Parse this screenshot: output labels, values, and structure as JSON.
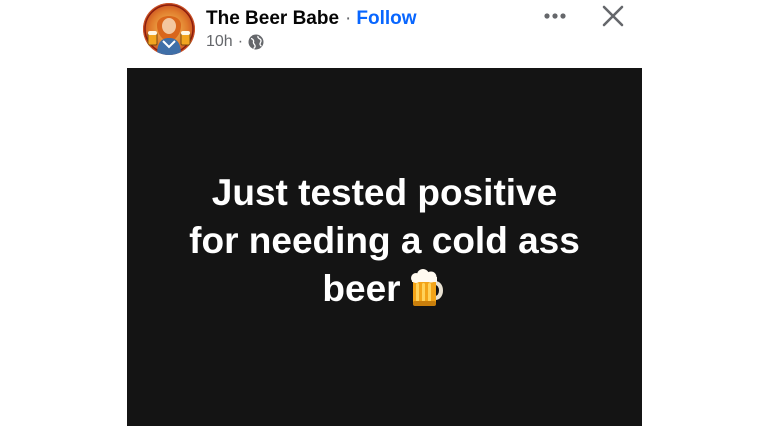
{
  "author": {
    "name": "The Beer Babe",
    "separator": "·",
    "follow_label": "Follow"
  },
  "meta": {
    "time": "10h",
    "separator": "·",
    "audience_icon": "globe-icon"
  },
  "actions": {
    "more_icon": "more-horizontal-icon",
    "close_icon": "close-icon"
  },
  "post": {
    "lines": [
      "Just tested positive",
      "for needing a cold ass",
      "beer"
    ],
    "emoji": "beer-mug-icon",
    "background_color": "#141414",
    "text_color": "#ffffff"
  },
  "colors": {
    "link": "#0866ff",
    "secondary_text": "#65676b",
    "primary_text": "#050505"
  }
}
